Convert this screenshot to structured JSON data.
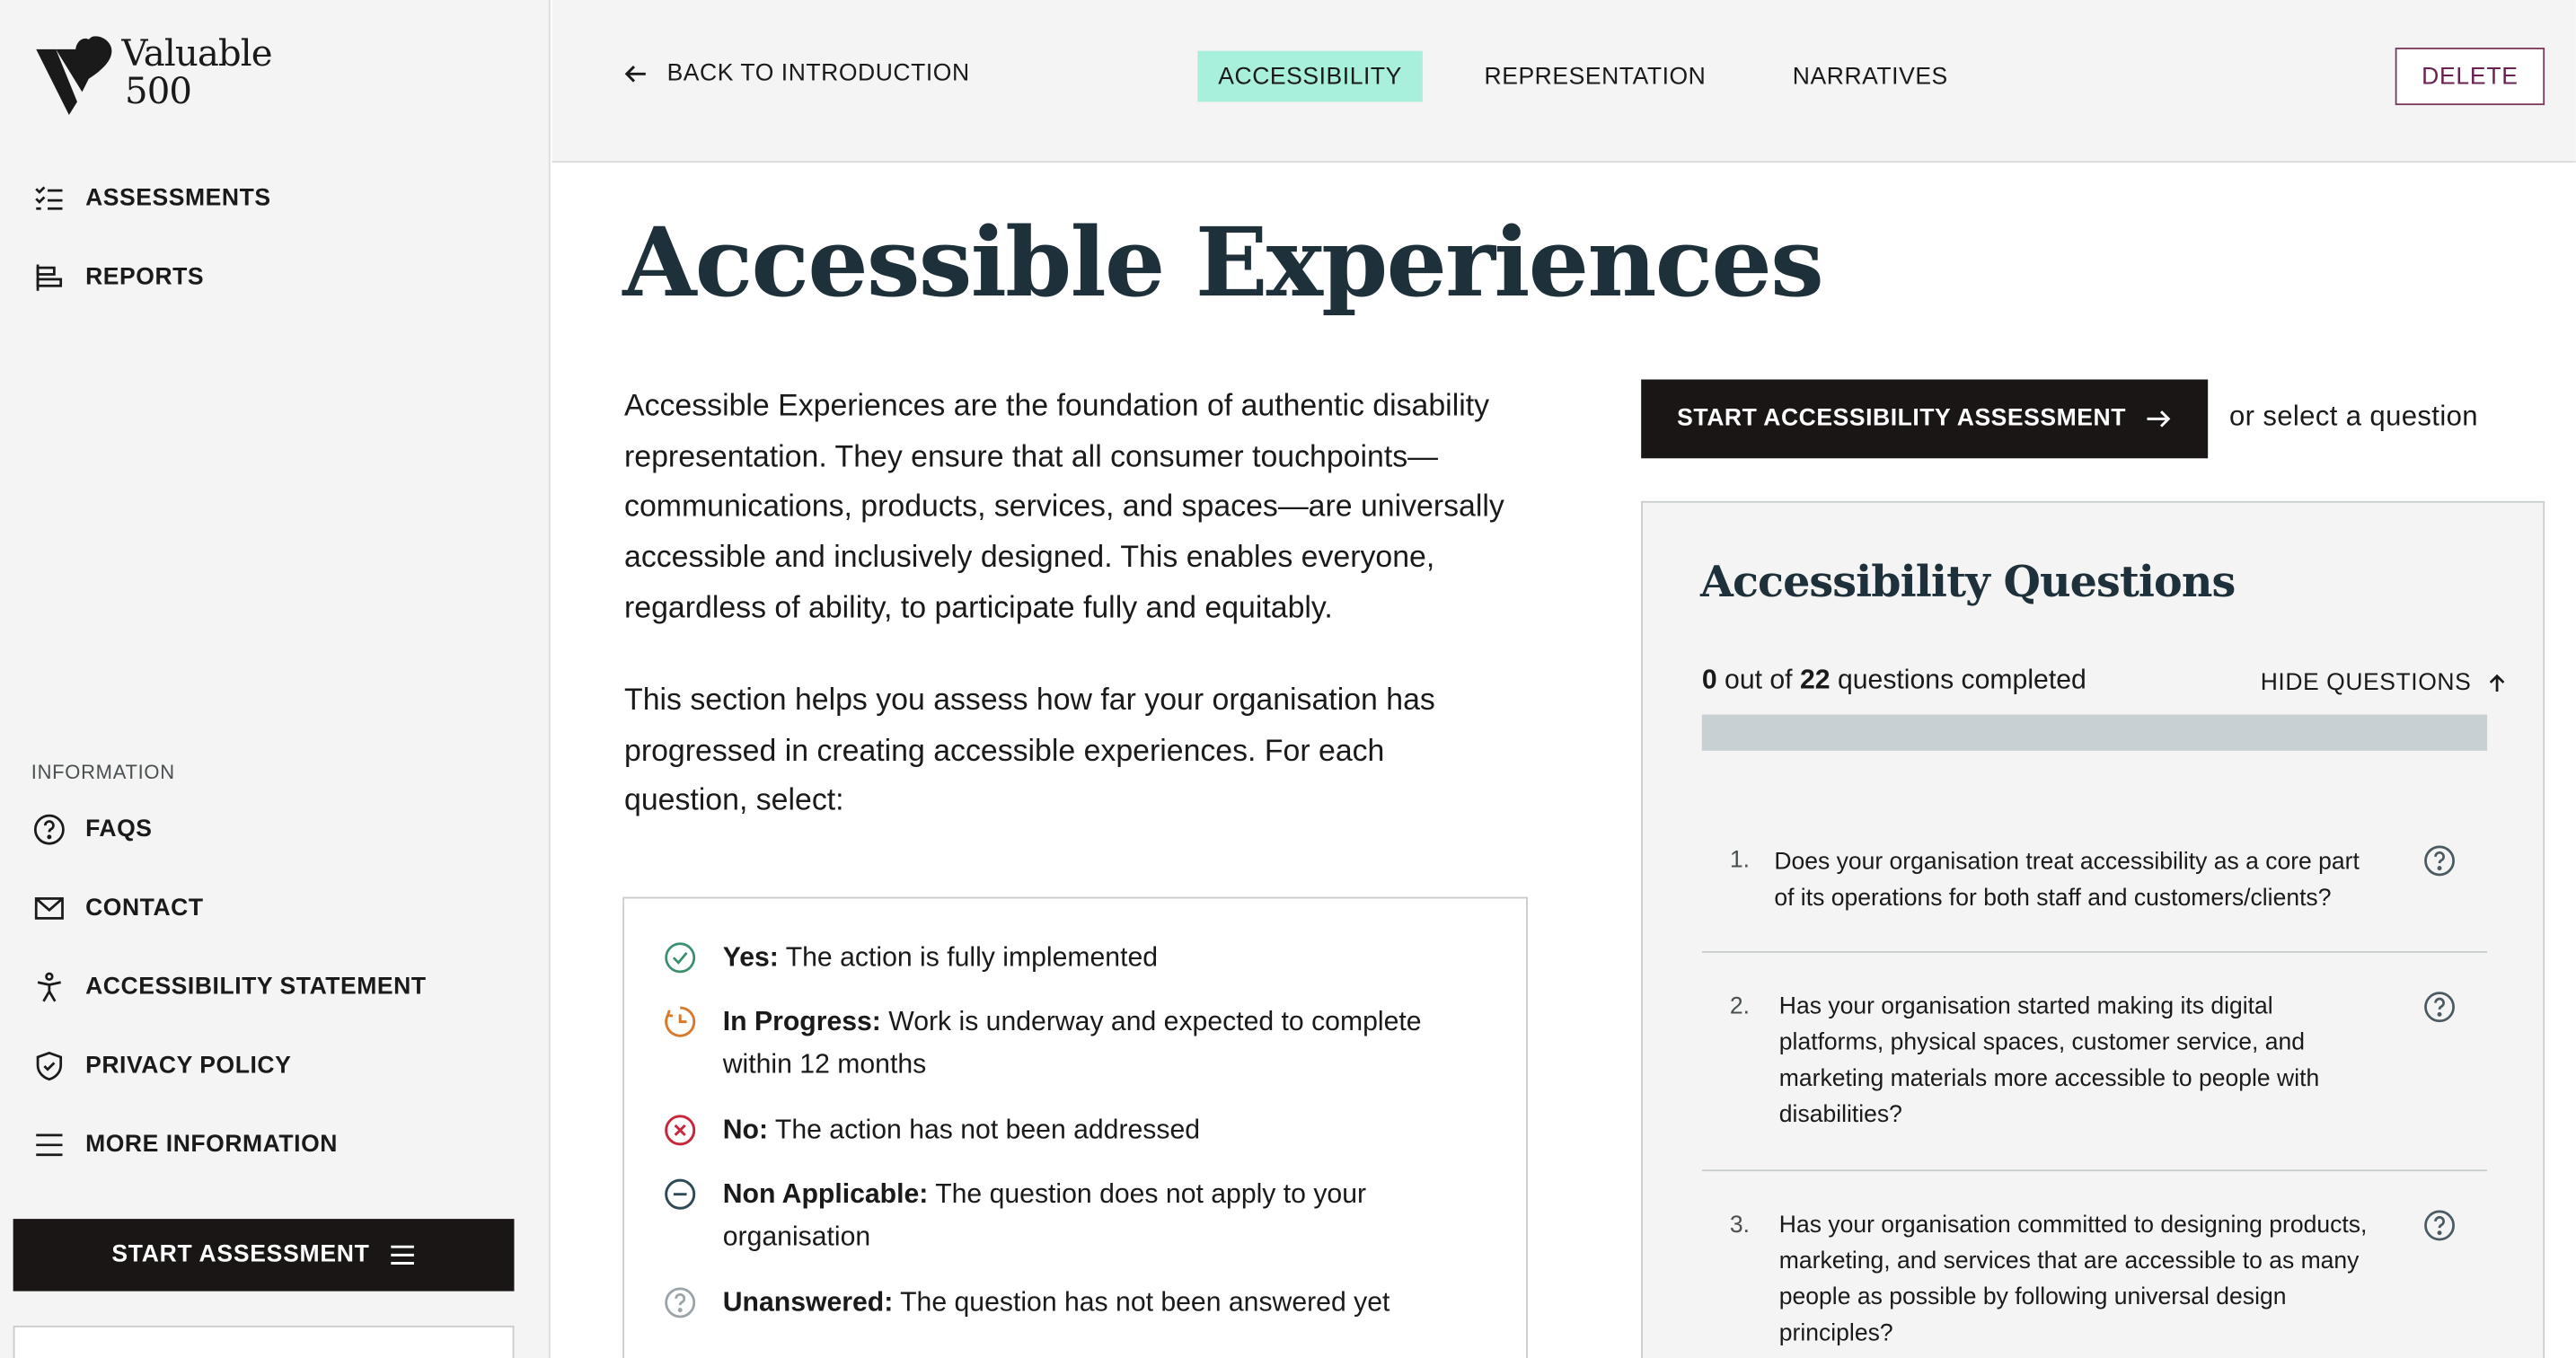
{
  "brand": {
    "name_line1": "Valuable",
    "name_line2": "500"
  },
  "sidebar": {
    "main_items": [
      {
        "label": "ASSESSMENTS",
        "icon": "checklist-icon"
      },
      {
        "label": "REPORTS",
        "icon": "reports-icon"
      }
    ],
    "info_label": "INFORMATION",
    "info_items": [
      {
        "label": "FAQS",
        "icon": "question-circle-icon"
      },
      {
        "label": "CONTACT",
        "icon": "mail-icon"
      },
      {
        "label": "ACCESSIBILITY STATEMENT",
        "icon": "accessibility-person-icon"
      },
      {
        "label": "PRIVACY POLICY",
        "icon": "shield-check-icon"
      },
      {
        "label": "MORE INFORMATION",
        "icon": "menu-icon"
      }
    ],
    "start_button": "START ASSESSMENT"
  },
  "topbar": {
    "back_label": "BACK TO INTRODUCTION",
    "tabs": [
      {
        "label": "ACCESSIBILITY",
        "active": true
      },
      {
        "label": "REPRESENTATION",
        "active": false
      },
      {
        "label": "NARRATIVES",
        "active": false
      }
    ],
    "delete_label": "DELETE"
  },
  "main": {
    "title": "Accessible Experiences",
    "intro": "Accessible Experiences are the foundation of authentic disability representation. They ensure that all consumer touchpoints—communications, products, services, and spaces—are universally accessible and inclusively designed. This enables everyone, regardless of ability, to participate fully and equitably.",
    "instructions": "This section helps you assess how far your organisation has progressed in creating accessible experiences. For each question, select:",
    "legend": [
      {
        "term": "Yes:",
        "desc": "The action is fully implemented",
        "icon": "check-circle-icon",
        "color": "#3a8f6e"
      },
      {
        "term": "In Progress:",
        "desc": "Work is underway and expected to complete within 12 months",
        "icon": "clock-progress-icon",
        "color": "#d97a2b"
      },
      {
        "term": "No:",
        "desc": "The action has not been addressed",
        "icon": "x-circle-icon",
        "color": "#c8263a"
      },
      {
        "term": "Non Applicable:",
        "desc": "The question does not apply to your organisation",
        "icon": "minus-circle-icon",
        "color": "#2e4a55"
      },
      {
        "term": "Unanswered:",
        "desc": "The question has not been answered yet",
        "icon": "question-circle-icon",
        "color": "#9aa3a8"
      }
    ],
    "assess_button": "START ACCESSIBILITY ASSESSMENT",
    "or_select": "or select a question",
    "questions_panel": {
      "title": "Accessibility Questions",
      "completed": "0",
      "out_of": "out of",
      "total": "22",
      "completed_suffix": "questions completed",
      "progress_fraction": 0,
      "hide_label": "HIDE QUESTIONS",
      "questions": [
        {
          "num": "1.",
          "text": "Does your organisation treat accessibility as a core part of its operations for both staff and customers/clients?"
        },
        {
          "num": "2.",
          "text": "Has your organisation started making its digital platforms, physical spaces, customer service, and marketing materials more accessible to people with disabilities?"
        },
        {
          "num": "3.",
          "text": "Has your organisation committed to designing products, marketing, and services that are accessible to as many people as possible by following universal design principles?"
        }
      ]
    }
  },
  "colors": {
    "accent_tab": "#a9f0dc",
    "dark_button": "#1b1616",
    "heading": "#1e313a",
    "delete": "#6b2150",
    "sidebar_bg": "#f3f4f3"
  }
}
